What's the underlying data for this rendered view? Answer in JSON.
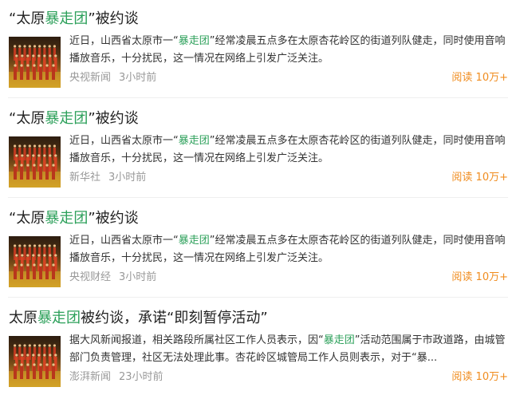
{
  "items": [
    {
      "title": {
        "prefix": "“太原",
        "keyword": "暴走团",
        "suffix": "”被约谈"
      },
      "summary": {
        "prefix": "近日，山西省太原市一“",
        "keyword": "暴走团",
        "suffix": "”经常凌晨五点多在太原杏花岭区的街道列队健走，同时使用音响播放音乐，十分扰民，这一情况在网络上引发广泛关注。"
      },
      "source": "央视新闻",
      "time": "3小时前",
      "reads": "阅读 10万+"
    },
    {
      "title": {
        "prefix": "“太原",
        "keyword": "暴走团",
        "suffix": "”被约谈"
      },
      "summary": {
        "prefix": "近日，山西省太原市一“",
        "keyword": "暴走团",
        "suffix": "”经常凌晨五点多在太原杏花岭区的街道列队健走，同时使用音响播放音乐，十分扰民，这一情况在网络上引发广泛关注。"
      },
      "source": "新华社",
      "time": "3小时前",
      "reads": "阅读 10万+"
    },
    {
      "title": {
        "prefix": "“太原",
        "keyword": "暴走团",
        "suffix": "”被约谈"
      },
      "summary": {
        "prefix": "近日，山西省太原市一“",
        "keyword": "暴走团",
        "suffix": "”经常凌晨五点多在太原杏花岭区的街道列队健走，同时使用音响播放音乐，十分扰民，这一情况在网络上引发广泛关注。"
      },
      "source": "央视财经",
      "time": "3小时前",
      "reads": "阅读 10万+"
    },
    {
      "title": {
        "prefix": "太原",
        "keyword": "暴走团",
        "suffix": "被约谈，承诺“即刻暂停活动”"
      },
      "summary": {
        "prefix": "据大风新闻报道，相关路段所属社区工作人员表示，因“",
        "keyword": "暴走团",
        "suffix": "”活动范围属于市政道路，由城管部门负责管理，社区无法处理此事。杏花岭区城管局工作人员则表示，对于“暴..."
      },
      "source": "澎湃新闻",
      "time": "23小时前",
      "reads": "阅读 10万+"
    }
  ],
  "colors": {
    "keyword_highlight": "#2ca05a",
    "reads": "#f08c1e",
    "meta": "#999999"
  },
  "thumbnail": {
    "icon": "walking-group-photo"
  }
}
